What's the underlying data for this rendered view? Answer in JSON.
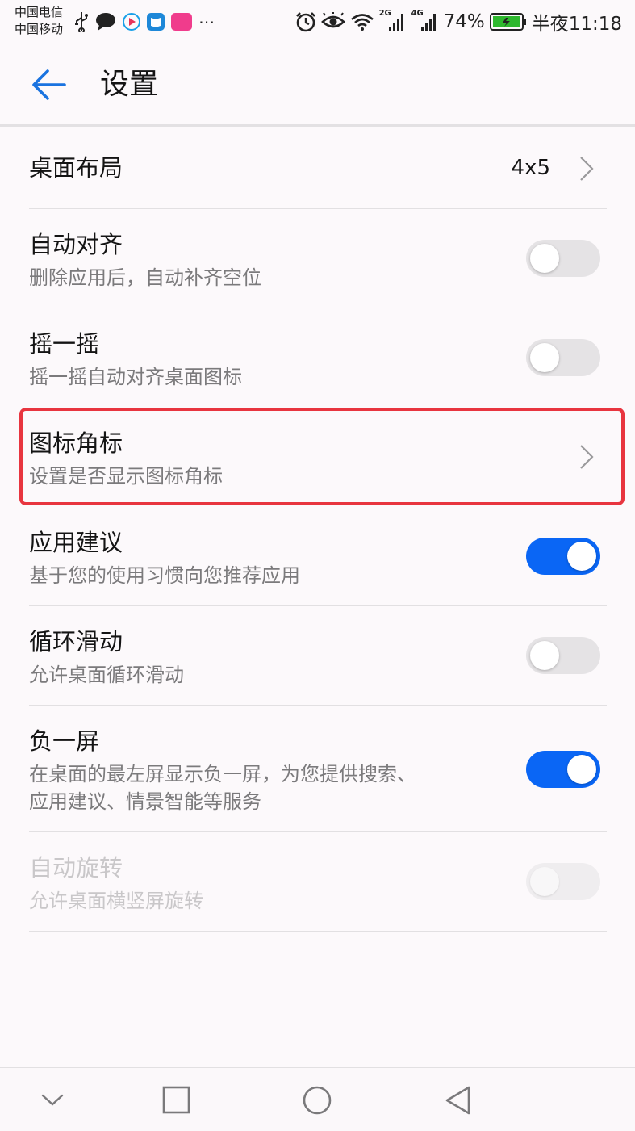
{
  "status_bar": {
    "carrier_1": "中国电信",
    "carrier_2": "中国移动",
    "battery": "74%",
    "time": "半夜11:18",
    "left_icons": [
      "usb-icon",
      "chat-bubble-icon",
      "video-app-icon",
      "book-app-icon",
      "shopping-app-icon",
      "more-dots-icon"
    ],
    "right_icons": [
      "alarm-icon",
      "eye-icon",
      "wifi-icon",
      "signal-2g-icon",
      "signal-4g-icon",
      "battery-icon"
    ],
    "net_1": "2G",
    "net_2": "4G"
  },
  "header": {
    "title": "设置",
    "back_icon": "arrow-left-icon"
  },
  "settings": [
    {
      "title": "桌面布局",
      "value": "4x5",
      "control": "chevron"
    },
    {
      "title": "自动对齐",
      "subtitle": "删除应用后，自动补齐空位",
      "control": "toggle",
      "on": false
    },
    {
      "title": "摇一摇",
      "subtitle": "摇一摇自动对齐桌面图标",
      "control": "toggle",
      "on": false
    },
    {
      "title": "图标角标",
      "subtitle": "设置是否显示图标角标",
      "control": "chevron",
      "highlighted": true
    },
    {
      "title": "应用建议",
      "subtitle": "基于您的使用习惯向您推荐应用",
      "control": "toggle",
      "on": true
    },
    {
      "title": "循环滑动",
      "subtitle": "允许桌面循环滑动",
      "control": "toggle",
      "on": false
    },
    {
      "title": "负一屏",
      "subtitle_line_1": "在桌面的最左屏显示负一屏，为您提供搜索、",
      "subtitle_line_2": "应用建议、情景智能等服务",
      "control": "toggle",
      "on": true
    },
    {
      "title": "自动旋转",
      "subtitle": "允许桌面横竖屏旋转",
      "control": "toggle",
      "on": false,
      "disabled": true
    }
  ],
  "nav_bar": [
    "chevron-down-icon",
    "recents-square-icon",
    "home-circle-icon",
    "back-triangle-icon"
  ],
  "colors": {
    "accent": "#0a66f5",
    "highlight_border": "#e8353f",
    "battery_green": "#2eb82e"
  }
}
